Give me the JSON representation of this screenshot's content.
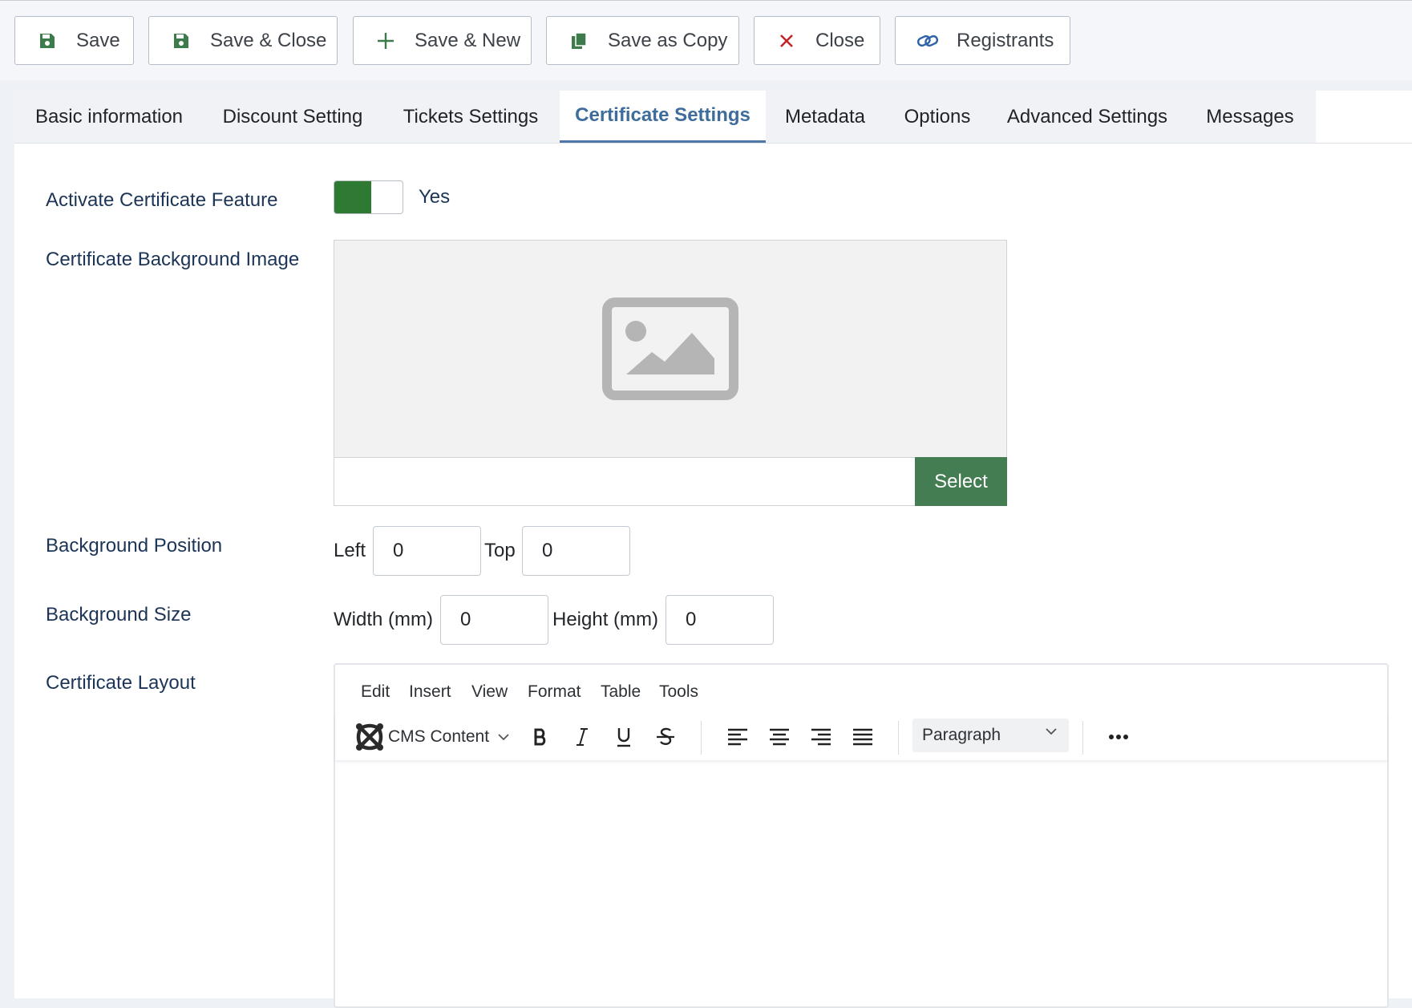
{
  "toolbar": {
    "save": "Save",
    "save_close": "Save & Close",
    "save_new": "Save & New",
    "save_copy": "Save as Copy",
    "close": "Close",
    "registrants": "Registrants"
  },
  "tabs": [
    {
      "label": "Basic information",
      "active": false
    },
    {
      "label": "Discount Setting",
      "active": false
    },
    {
      "label": "Tickets Settings",
      "active": false
    },
    {
      "label": "Certificate Settings",
      "active": true
    },
    {
      "label": "Metadata",
      "active": false
    },
    {
      "label": "Options",
      "active": false
    },
    {
      "label": "Advanced Settings",
      "active": false
    },
    {
      "label": "Messages",
      "active": false
    }
  ],
  "form": {
    "activate_label": "Activate Certificate Feature",
    "activate_value": "Yes",
    "bg_image_label": "Certificate Background Image",
    "bg_image_value": "",
    "select_label": "Select",
    "bg_position_label": "Background Position",
    "left_label": "Left",
    "left_value": "0",
    "top_label": "Top",
    "top_value": "0",
    "bg_size_label": "Background Size",
    "width_label": "Width (mm)",
    "width_value": "0",
    "height_label": "Height (mm)",
    "height_value": "0",
    "layout_label": "Certificate Layout"
  },
  "editor": {
    "menu": [
      "Edit",
      "Insert",
      "View",
      "Format",
      "Table",
      "Tools"
    ],
    "cms_content": "CMS Content",
    "block_format": "Paragraph"
  },
  "colors": {
    "accent_green": "#457d53",
    "toggle_green": "#2f7a33",
    "active_tab": "#3e6c9b",
    "label_navy": "#1c3557",
    "close_red": "#c0262b"
  }
}
